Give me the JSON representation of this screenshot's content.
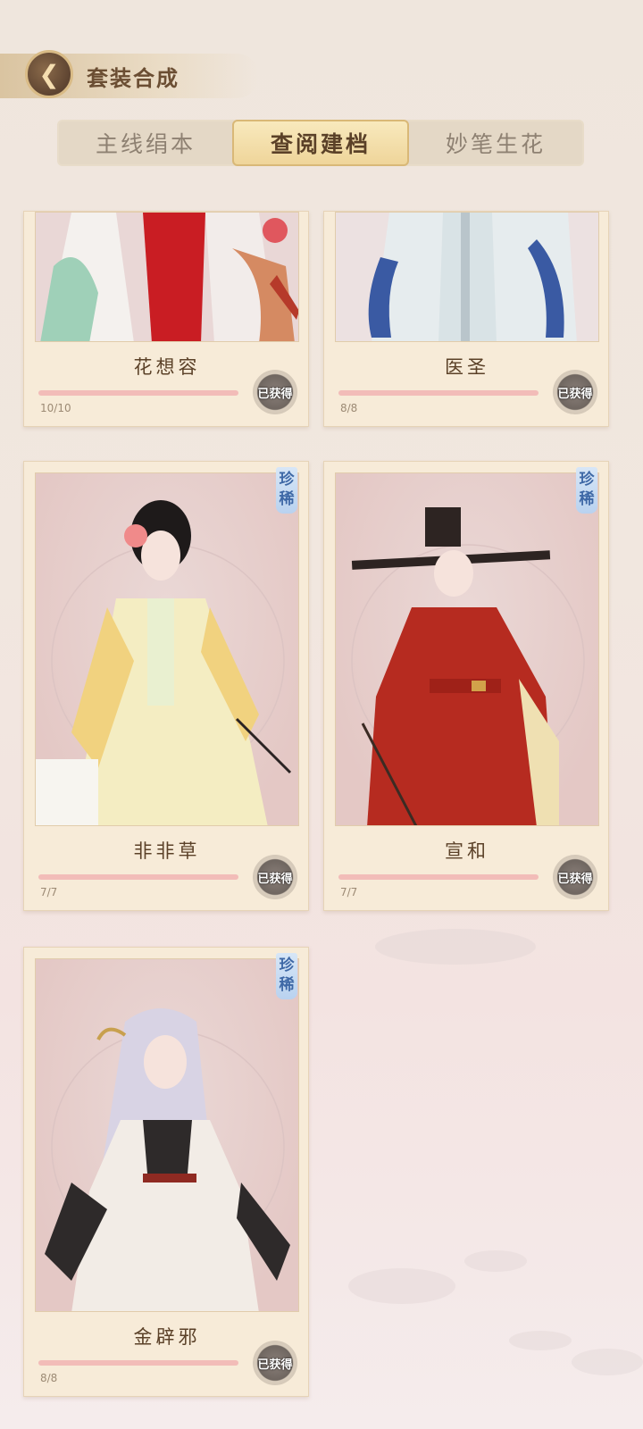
{
  "header": {
    "title": "套装合成"
  },
  "tabs": [
    {
      "label": "主线绢本"
    },
    {
      "label": "查阅建档"
    },
    {
      "label": "妙笔生花"
    }
  ],
  "cards": [
    {
      "name": "花想容",
      "count": "10/10",
      "badge": "已获得",
      "rare": "",
      "progress": 1.0
    },
    {
      "name": "医圣",
      "count": "8/8",
      "badge": "已获得",
      "rare": "",
      "progress": 1.0
    },
    {
      "name": "非非草",
      "count": "7/7",
      "badge": "已获得",
      "rare": "珍稀",
      "progress": 1.0
    },
    {
      "name": "宣和",
      "count": "7/7",
      "badge": "已获得",
      "rare": "珍稀",
      "progress": 1.0
    },
    {
      "name": "金辟邪",
      "count": "8/8",
      "badge": "已获得",
      "rare": "珍稀",
      "progress": 1.0
    }
  ],
  "colors": {
    "accent": "#efd59a",
    "progress": "#f2bcb8",
    "rare": "#3e68a6"
  }
}
